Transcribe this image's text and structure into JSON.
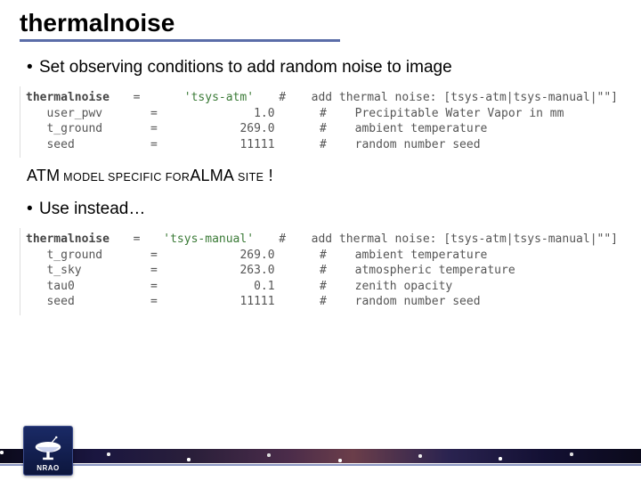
{
  "title": "thermalnoise",
  "bullet1": "Set observing conditions to add random noise to image",
  "code1": {
    "rows": [
      {
        "key": "thermalnoise",
        "eq": "=",
        "val": "'tsys-atm'",
        "hash": "#",
        "cmt": "add thermal noise: [tsys-atm|tsys-manual|\"\"]",
        "bold": true,
        "green": true
      },
      {
        "key": "user_pwv",
        "eq": "=",
        "val": "1.0",
        "hash": "#",
        "cmt": "Precipitable Water Vapor in mm"
      },
      {
        "key": "t_ground",
        "eq": "=",
        "val": "269.0",
        "hash": "#",
        "cmt": "ambient temperature"
      },
      {
        "key": "seed",
        "eq": "=",
        "val": "11111",
        "hash": "#",
        "cmt": "random number seed"
      }
    ]
  },
  "midline": {
    "p1": "ATM",
    "p2": " MODEL SPECIFIC FOR",
    "p3": "ALMA",
    "p4": " SITE",
    "p5": " !"
  },
  "bullet2": "Use instead…",
  "code2": {
    "rows": [
      {
        "key": "thermalnoise",
        "eq": "=",
        "val": "'tsys-manual'",
        "hash": "#",
        "cmt": "add thermal noise: [tsys-atm|tsys-manual|\"\"]",
        "bold": true,
        "green": true
      },
      {
        "key": "t_ground",
        "eq": "=",
        "val": "269.0",
        "hash": "#",
        "cmt": "ambient temperature"
      },
      {
        "key": "t_sky",
        "eq": "=",
        "val": "263.0",
        "hash": "#",
        "cmt": "atmospheric temperature"
      },
      {
        "key": "tau0",
        "eq": "=",
        "val": "0.1",
        "hash": "#",
        "cmt": "zenith opacity"
      },
      {
        "key": "seed",
        "eq": "=",
        "val": "11111",
        "hash": "#",
        "cmt": "random number seed"
      }
    ]
  },
  "logo_text": "NRAO"
}
